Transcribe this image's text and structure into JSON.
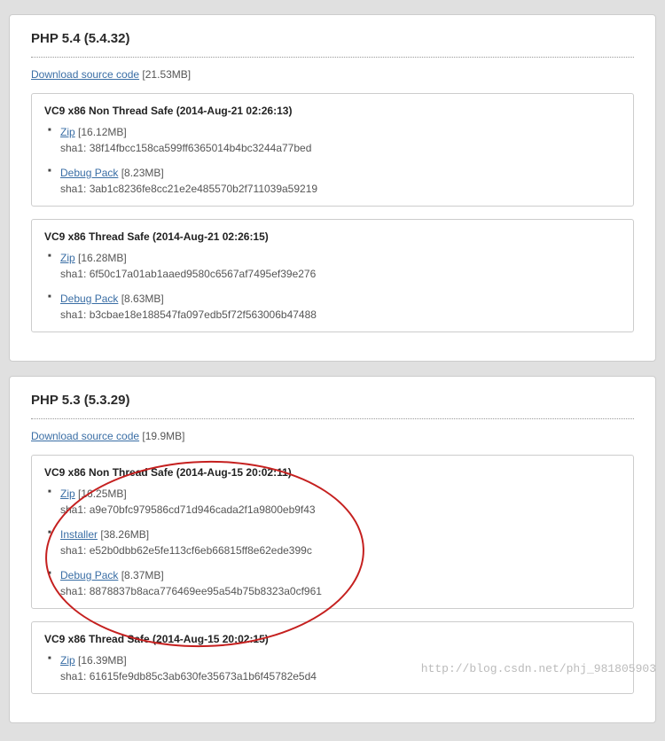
{
  "sections": [
    {
      "title": "PHP 5.4 (5.4.32)",
      "source_link": "Download source code",
      "source_size": "[21.53MB]",
      "builds": [
        {
          "title": "VC9 x86 Non Thread Safe (2014-Aug-21 02:26:13)",
          "items": [
            {
              "link": "Zip",
              "size": "[16.12MB]",
              "sha": "sha1: 38f14fbcc158ca599ff6365014b4bc3244a77bed"
            },
            {
              "link": "Debug Pack",
              "size": "[8.23MB]",
              "sha": "sha1: 3ab1c8236fe8cc21e2e485570b2f711039a59219"
            }
          ]
        },
        {
          "title": "VC9 x86 Thread Safe (2014-Aug-21 02:26:15)",
          "items": [
            {
              "link": "Zip",
              "size": "[16.28MB]",
              "sha": "sha1: 6f50c17a01ab1aaed9580c6567af7495ef39e276"
            },
            {
              "link": "Debug Pack",
              "size": "[8.63MB]",
              "sha": "sha1: b3cbae18e188547fa097edb5f72f563006b47488"
            }
          ]
        }
      ]
    },
    {
      "title": "PHP 5.3 (5.3.29)",
      "source_link": "Download source code",
      "source_size": "[19.9MB]",
      "annotated": true,
      "builds": [
        {
          "title": "VC9 x86 Non Thread Safe (2014-Aug-15 20:02:11)",
          "items": [
            {
              "link": "Zip",
              "size": "[16.25MB]",
              "sha": "sha1: a9e70bfc979586cd71d946cada2f1a9800eb9f43"
            },
            {
              "link": "Installer",
              "size": "[38.26MB]",
              "sha": "sha1: e52b0dbb62e5fe113cf6eb66815ff8e62ede399c"
            },
            {
              "link": "Debug Pack",
              "size": "[8.37MB]",
              "sha": "sha1: 8878837b8aca776469ee95a54b75b8323a0cf961"
            }
          ]
        },
        {
          "title": "VC9 x86 Thread Safe (2014-Aug-15 20:02:15)",
          "items": [
            {
              "link": "Zip",
              "size": "[16.39MB]",
              "sha": "sha1: 61615fe9db85c3ab630fe35673a1b6f45782e5d4"
            }
          ]
        }
      ]
    }
  ],
  "watermark": "http://blog.csdn.net/phj_981805903"
}
